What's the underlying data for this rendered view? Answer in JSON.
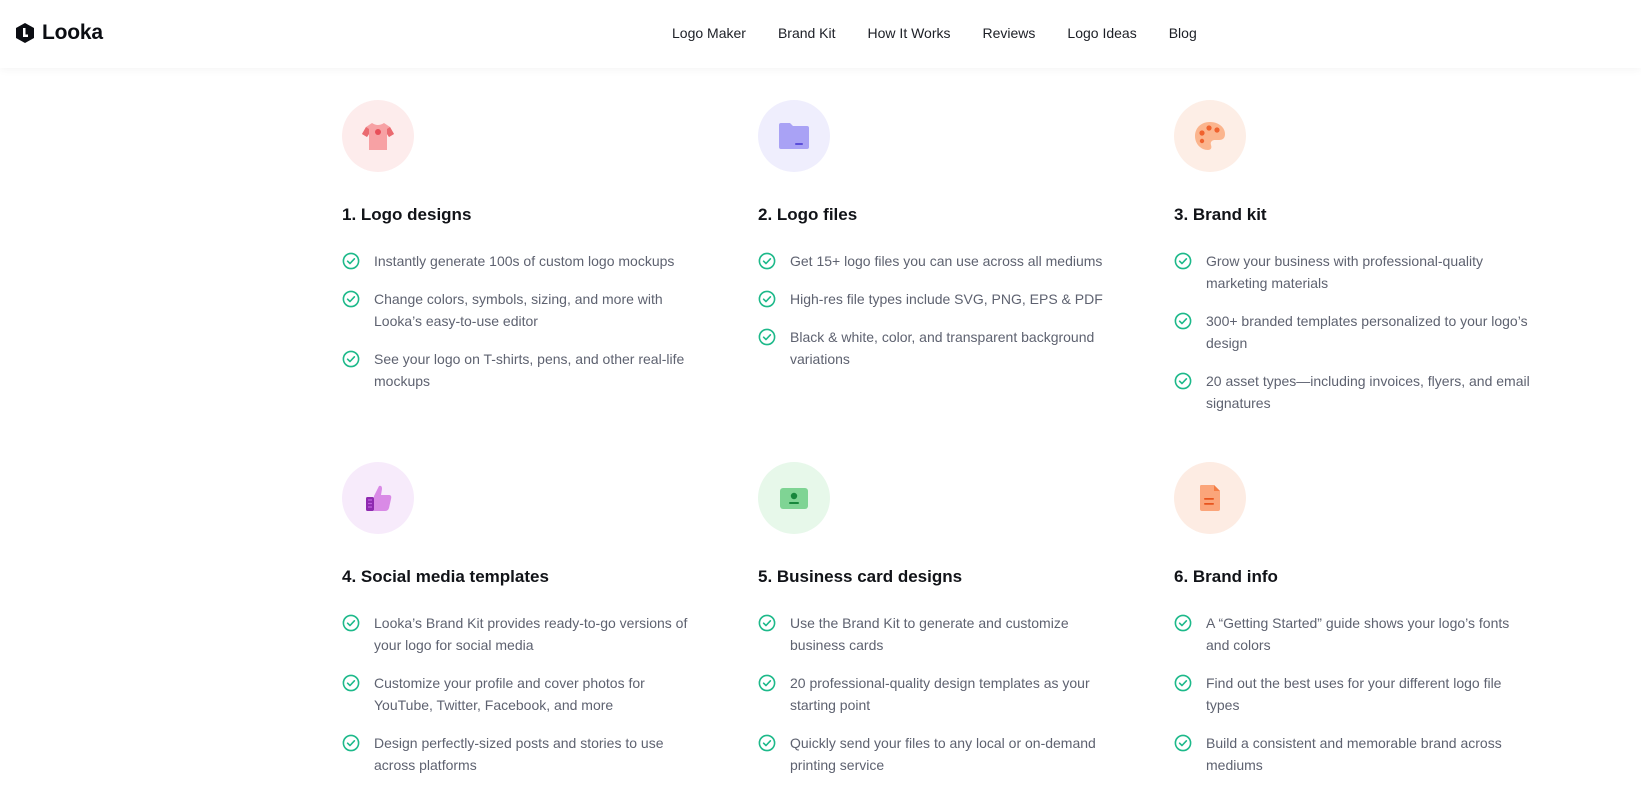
{
  "brand": {
    "name": "Looka"
  },
  "nav": [
    "Logo Maker",
    "Brand Kit",
    "How It Works",
    "Reviews",
    "Logo Ideas",
    "Blog"
  ],
  "colors": {
    "check": "#1db98a",
    "text_muted": "#5e6270"
  },
  "features": [
    {
      "title": "1. Logo designs",
      "icon": "tshirt-icon",
      "icon_bg": "#fdecec",
      "items": [
        "Instantly generate 100s of custom logo mockups",
        "Change colors, symbols, sizing, and more with Looka’s easy-to-use editor",
        "See your logo on T-shirts, pens, and other real-life mockups"
      ]
    },
    {
      "title": "2. Logo files",
      "icon": "folder-icon",
      "icon_bg": "#efeefd",
      "items": [
        "Get 15+ logo files you can use across all mediums",
        "High-res file types include SVG, PNG, EPS & PDF",
        "Black & white, color, and transparent background variations"
      ]
    },
    {
      "title": "3. Brand kit",
      "icon": "palette-icon",
      "icon_bg": "#fdeee6",
      "items": [
        "Grow your business with professional-quality marketing materials",
        "300+ branded templates personalized to your logo’s design",
        "20 asset types—including invoices, flyers, and email signatures"
      ]
    },
    {
      "title": "4. Social media templates",
      "icon": "thumbs-up-icon",
      "icon_bg": "#f7ebfb",
      "items": [
        "Looka’s Brand Kit provides ready-to-go versions of your logo for social media",
        "Customize your profile and cover photos for YouTube, Twitter, Facebook, and more",
        "Design perfectly-sized posts and stories to use across platforms"
      ]
    },
    {
      "title": "5. Business card designs",
      "icon": "id-card-icon",
      "icon_bg": "#e7f8ea",
      "items": [
        "Use the Brand Kit to generate and customize business cards",
        "20 professional-quality design templates as your starting point",
        "Quickly send your files to any local or on-demand printing service"
      ]
    },
    {
      "title": "6. Brand info",
      "icon": "document-icon",
      "icon_bg": "#fdece3",
      "items": [
        "A “Getting Started” guide shows your logo’s fonts and colors",
        "Find out the best uses for your different logo file types",
        "Build a consistent and memorable brand across mediums"
      ]
    }
  ]
}
